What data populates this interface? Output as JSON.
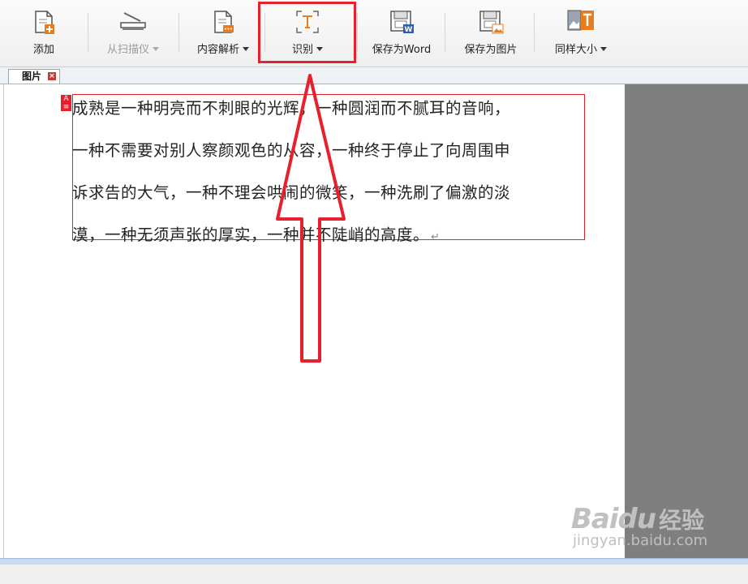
{
  "toolbar": {
    "add_label": "添加",
    "scan_label": "从扫描仪",
    "parse_label": "内容解析",
    "recognize_label": "识别",
    "save_word_label": "保存为Word",
    "save_image_label": "保存为图片",
    "same_size_label": "同样大小"
  },
  "tab": {
    "label": "图片"
  },
  "document": {
    "lines": [
      "成熟是一种明亮而不刺眼的光辉，一种圆润而不腻耳的音响，",
      "一种不需要对别人察颜观色的从容，一种终于停止了向周围申",
      "诉求告的大气，一种不理会哄闹的微笑，一种洗刷了偏激的淡",
      "漠，一种无须声张的厚实，一种并不陡峭的高度。"
    ],
    "region_tag": "A"
  },
  "watermark": {
    "brand": "Bai",
    "brand2": "du",
    "cn": "经验",
    "url": "jingyan.baidu.com"
  },
  "colors": {
    "highlight": "#e8202d",
    "icon_orange": "#e87d1e",
    "side_pane": "#7f7f7f"
  }
}
